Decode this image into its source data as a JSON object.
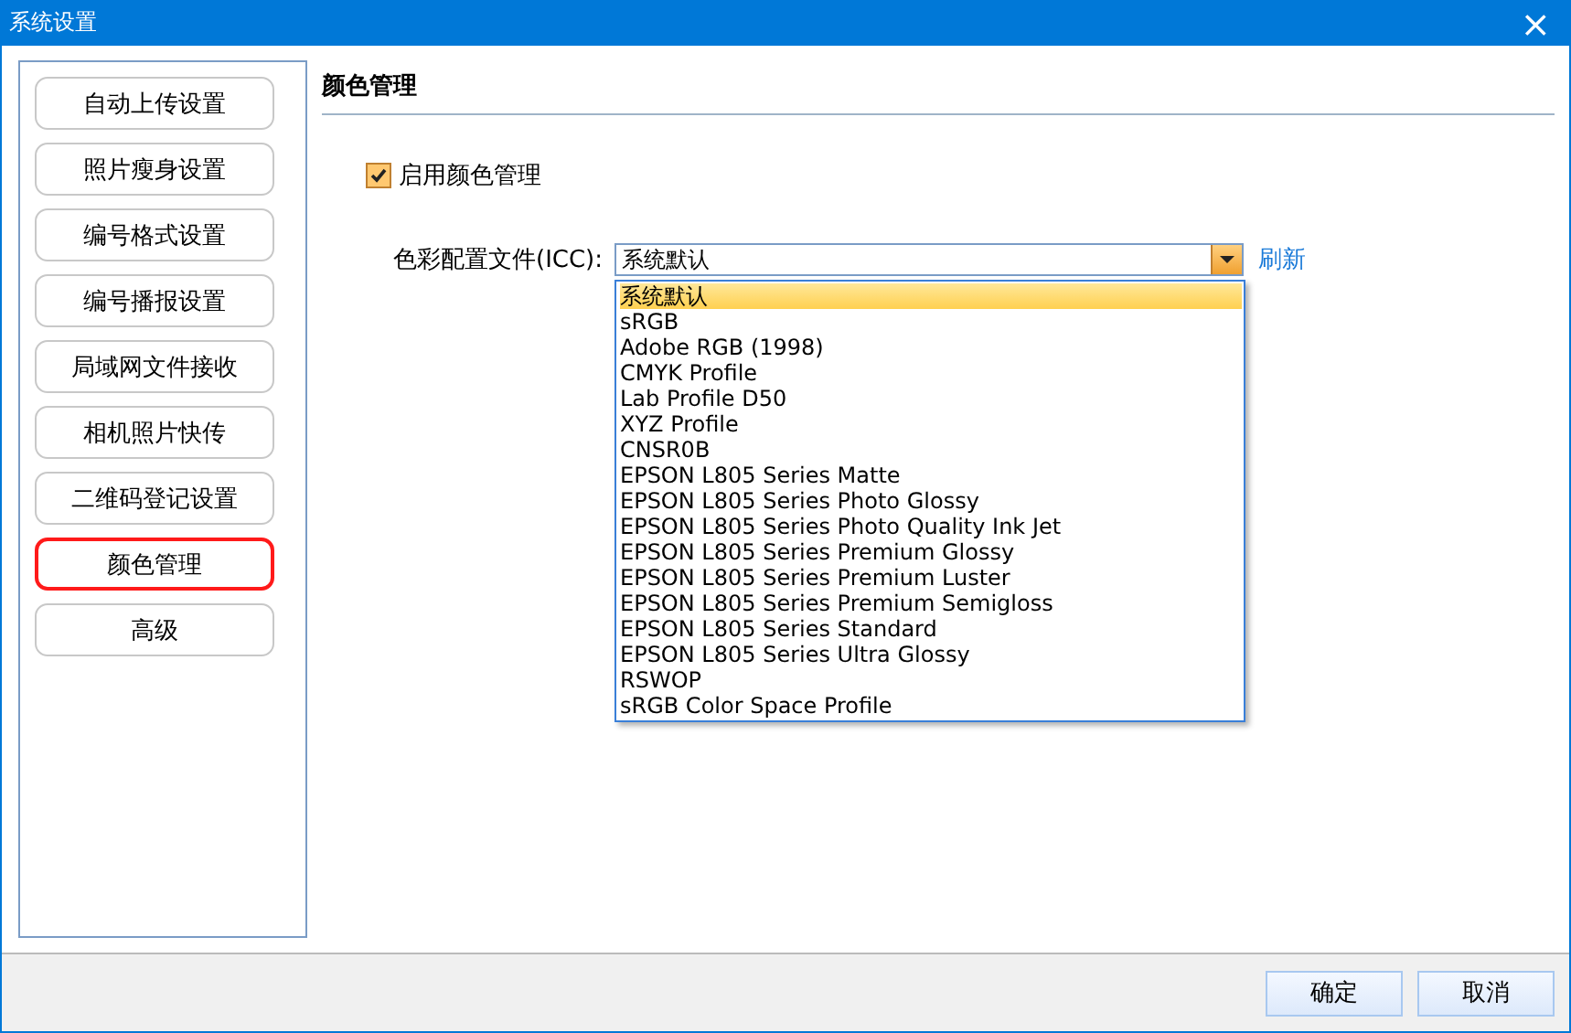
{
  "window": {
    "title": "系统设置",
    "close": "×"
  },
  "sidebar": {
    "items": [
      {
        "label": "自动上传设置",
        "selected": false
      },
      {
        "label": "照片瘦身设置",
        "selected": false
      },
      {
        "label": "编号格式设置",
        "selected": false
      },
      {
        "label": "编号播报设置",
        "selected": false
      },
      {
        "label": "局域网文件接收",
        "selected": false
      },
      {
        "label": "相机照片快传",
        "selected": false
      },
      {
        "label": "二维码登记设置",
        "selected": false
      },
      {
        "label": "颜色管理",
        "selected": true
      },
      {
        "label": "高级",
        "selected": false
      }
    ]
  },
  "section": {
    "title": "颜色管理"
  },
  "enable_checkbox": {
    "label": "启用颜色管理",
    "checked": true
  },
  "icc": {
    "label": "色彩配置文件(ICC):",
    "value": "系统默认",
    "expanded": true,
    "refresh": "刷新",
    "options": [
      {
        "label": "系统默认",
        "selected": true
      },
      {
        "label": "sRGB",
        "selected": false
      },
      {
        "label": "Adobe RGB (1998)",
        "selected": false
      },
      {
        "label": "CMYK Profile",
        "selected": false
      },
      {
        "label": "Lab Profile D50",
        "selected": false
      },
      {
        "label": "XYZ Profile",
        "selected": false
      },
      {
        "label": "CNSR0B",
        "selected": false
      },
      {
        "label": "EPSON L805 Series Matte",
        "selected": false
      },
      {
        "label": "EPSON L805 Series Photo Glossy",
        "selected": false
      },
      {
        "label": "EPSON L805 Series Photo Quality Ink Jet",
        "selected": false
      },
      {
        "label": "EPSON L805 Series Premium Glossy",
        "selected": false
      },
      {
        "label": "EPSON L805 Series Premium Luster",
        "selected": false
      },
      {
        "label": "EPSON L805 Series Premium Semigloss",
        "selected": false
      },
      {
        "label": "EPSON L805 Series Standard",
        "selected": false
      },
      {
        "label": "EPSON L805 Series Ultra Glossy",
        "selected": false
      },
      {
        "label": "RSWOP",
        "selected": false
      },
      {
        "label": "sRGB Color Space Profile",
        "selected": false
      }
    ]
  },
  "buttons": [
    "确定",
    "取消"
  ]
}
